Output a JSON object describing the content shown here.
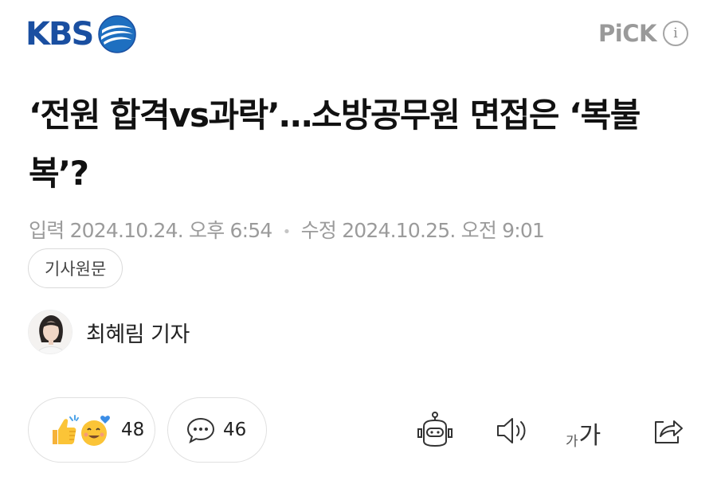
{
  "header": {
    "logo_text": "KBS",
    "pick_label": "PiCK",
    "info_symbol": "i"
  },
  "article": {
    "headline": "‘전원 합격vs과락’…소방공무원 면접은 ‘복불복’?",
    "published_label": "입력",
    "published_date": "2024.10.24. 오후 6:54",
    "separator": "•",
    "modified_label": "수정",
    "modified_date": "2024.10.25. 오전 9:01",
    "source_button_label": "기사원문",
    "reporter_name": "최혜림 기자"
  },
  "actions": {
    "reaction_count": "48",
    "comment_count": "46",
    "font_small_label": "가",
    "font_large_label": "가"
  },
  "colors": {
    "brand_blue": "#1a4fa1",
    "pick_gray": "#9a9a9a",
    "meta_gray": "#9b9b9b"
  },
  "icons": [
    "kbs-logo-mark",
    "info-icon",
    "reaction-emoji-icons",
    "speech-bubble-icon",
    "ai-robot-icon",
    "speaker-icon",
    "share-icon"
  ]
}
